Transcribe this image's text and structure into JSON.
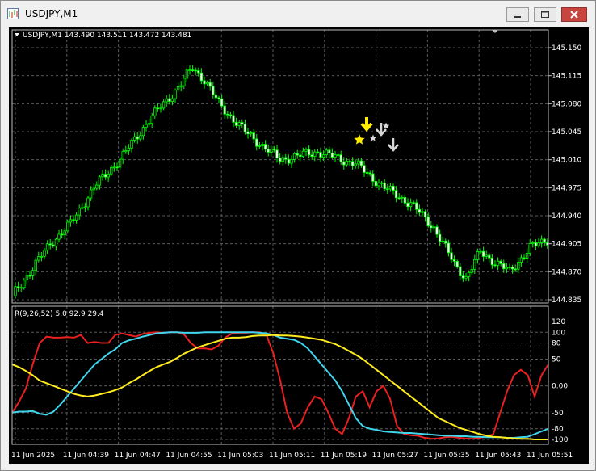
{
  "window": {
    "title": "USDJPY,M1"
  },
  "colors": {
    "background": "#000000",
    "grid": "#5a5a5a",
    "candle_up_body": "#000000",
    "candle_down_body": "#ffffff",
    "candle_outline": "#00ff00",
    "axis_text": "#ffffff",
    "indicator_red": "#e8201f",
    "indicator_cyan": "#3fd6ee",
    "indicator_yellow": "#ffec1f",
    "arrow_yellow": "#ffee00",
    "arrow_white": "#d8d8d8"
  },
  "main_chart": {
    "header": "USDJPY,M1  143.490 143.511 143.472 143.481",
    "price_levels": [
      "145.150",
      "145.115",
      "145.080",
      "145.045",
      "145.010",
      "144.975",
      "144.940",
      "144.905",
      "144.870",
      "144.835"
    ],
    "price_range": [
      144.835,
      145.15
    ]
  },
  "indicator": {
    "header": "R(9,26,52) 5.0 92.9 29.4",
    "levels": [
      "120",
      "100",
      "80",
      "50",
      "0.00",
      "-50",
      "-80",
      "-100"
    ],
    "range": [
      -100,
      100
    ]
  },
  "time_axis": {
    "labels": [
      "11 Jun 2025",
      "11 Jun 04:39",
      "11 Jun 04:47",
      "11 Jun 04:55",
      "11 Jun 05:03",
      "11 Jun 05:11",
      "11 Jun 05:19",
      "11 Jun 05:27",
      "11 Jun 05:35",
      "11 Jun 05:43",
      "11 Jun 05:51"
    ]
  },
  "chart_data": {
    "type": "line",
    "series": [
      {
        "name": "red",
        "values": [
          -50,
          -30,
          -5,
          40,
          80,
          92,
          90,
          90,
          91,
          90,
          95,
          80,
          82,
          80,
          80,
          95,
          98,
          95,
          92,
          97,
          99,
          100,
          99,
          100,
          100,
          96,
          80,
          70,
          70,
          68,
          75,
          90,
          98,
          99,
          99,
          100,
          100,
          95,
          60,
          10,
          -50,
          -80,
          -70,
          -40,
          -20,
          -25,
          -50,
          -80,
          -90,
          -60,
          -20,
          -10,
          -40,
          -10,
          0,
          -25,
          -75,
          -90,
          -92,
          -93,
          -97,
          -99,
          -98,
          -96,
          -95,
          -97,
          -98,
          -99,
          -97,
          -95,
          -90,
          -50,
          -10,
          20,
          30,
          20,
          -20,
          20,
          40
        ]
      },
      {
        "name": "cyan",
        "values": [
          -50,
          -48,
          -48,
          -47,
          -52,
          -54,
          -48,
          -35,
          -20,
          -5,
          10,
          25,
          40,
          50,
          60,
          68,
          80,
          85,
          88,
          92,
          95,
          98,
          99,
          100,
          100,
          99,
          99,
          99,
          100,
          100,
          100,
          100,
          100,
          100,
          100,
          100,
          99,
          98,
          95,
          90,
          88,
          86,
          80,
          70,
          55,
          40,
          25,
          10,
          -10,
          -35,
          -60,
          -75,
          -80,
          -82,
          -85,
          -86,
          -87,
          -88,
          -88,
          -89,
          -90,
          -91,
          -92,
          -93,
          -93,
          -94,
          -94,
          -95,
          -95,
          -96,
          -96,
          -96,
          -97,
          -97,
          -96,
          -95,
          -90,
          -85,
          -80
        ]
      },
      {
        "name": "yellow",
        "values": [
          40,
          35,
          28,
          20,
          10,
          5,
          0,
          -5,
          -10,
          -15,
          -18,
          -20,
          -18,
          -15,
          -12,
          -8,
          -3,
          5,
          12,
          20,
          28,
          35,
          40,
          45,
          52,
          60,
          66,
          72,
          76,
          80,
          84,
          88,
          90,
          90,
          91,
          93,
          94,
          94,
          95,
          94,
          94,
          93,
          92,
          90,
          88,
          86,
          82,
          78,
          72,
          65,
          58,
          50,
          40,
          30,
          20,
          10,
          0,
          -10,
          -20,
          -30,
          -40,
          -50,
          -60,
          -66,
          -72,
          -78,
          -82,
          -86,
          -90,
          -93,
          -95,
          -96,
          -97,
          -98,
          -99,
          -99,
          -100,
          -100,
          -100
        ]
      }
    ],
    "ylim": [
      -100,
      120
    ]
  }
}
